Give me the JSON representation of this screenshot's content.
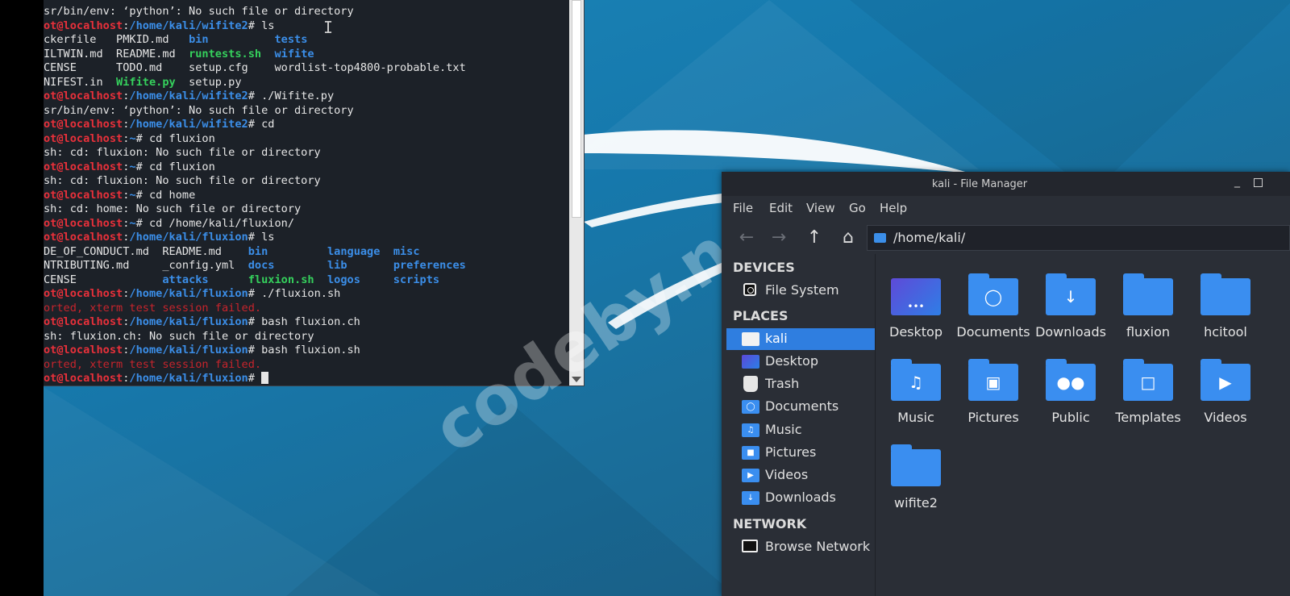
{
  "terminal": {
    "lines": [
      [
        {
          "t": "sr/bin/env: ‘python’: No such file or directory",
          "c": ""
        }
      ],
      [
        {
          "t": "ot@localhost",
          "c": "red"
        },
        {
          "t": ":",
          "c": ""
        },
        {
          "t": "/home/kali/wifite2",
          "c": "blue"
        },
        {
          "t": "# ls",
          "c": ""
        }
      ],
      [
        {
          "t": "ckerfile   PMKID.md   ",
          "c": ""
        },
        {
          "t": "bin",
          "c": "blue"
        },
        {
          "t": "          ",
          "c": ""
        },
        {
          "t": "tests",
          "c": "blue"
        }
      ],
      [
        {
          "t": "ILTWIN.md  README.md  ",
          "c": ""
        },
        {
          "t": "runtests.sh",
          "c": "green"
        },
        {
          "t": "  ",
          "c": ""
        },
        {
          "t": "wifite",
          "c": "blue"
        }
      ],
      [
        {
          "t": "CENSE      TODO.md    setup.cfg    wordlist-top4800-probable.txt",
          "c": ""
        }
      ],
      [
        {
          "t": "NIFEST.in  ",
          "c": ""
        },
        {
          "t": "Wifite.py",
          "c": "green"
        },
        {
          "t": "  setup.py",
          "c": ""
        }
      ],
      [
        {
          "t": "ot@localhost",
          "c": "red"
        },
        {
          "t": ":",
          "c": ""
        },
        {
          "t": "/home/kali/wifite2",
          "c": "blue"
        },
        {
          "t": "# ./Wifite.py",
          "c": ""
        }
      ],
      [
        {
          "t": "sr/bin/env: ‘python’: No such file or directory",
          "c": ""
        }
      ],
      [
        {
          "t": "ot@localhost",
          "c": "red"
        },
        {
          "t": ":",
          "c": ""
        },
        {
          "t": "/home/kali/wifite2",
          "c": "blue"
        },
        {
          "t": "# cd",
          "c": ""
        }
      ],
      [
        {
          "t": "ot@localhost",
          "c": "red"
        },
        {
          "t": ":",
          "c": ""
        },
        {
          "t": "~",
          "c": "blue"
        },
        {
          "t": "# cd fluxion",
          "c": ""
        }
      ],
      [
        {
          "t": "sh: cd: fluxion: No such file or directory",
          "c": ""
        }
      ],
      [
        {
          "t": "ot@localhost",
          "c": "red"
        },
        {
          "t": ":",
          "c": ""
        },
        {
          "t": "~",
          "c": "blue"
        },
        {
          "t": "# cd fluxion",
          "c": ""
        }
      ],
      [
        {
          "t": "sh: cd: fluxion: No such file or directory",
          "c": ""
        }
      ],
      [
        {
          "t": "ot@localhost",
          "c": "red"
        },
        {
          "t": ":",
          "c": ""
        },
        {
          "t": "~",
          "c": "blue"
        },
        {
          "t": "# cd home",
          "c": ""
        }
      ],
      [
        {
          "t": "sh: cd: home: No such file or directory",
          "c": ""
        }
      ],
      [
        {
          "t": "ot@localhost",
          "c": "red"
        },
        {
          "t": ":",
          "c": ""
        },
        {
          "t": "~",
          "c": "blue"
        },
        {
          "t": "# cd /home/kali/fluxion/",
          "c": ""
        }
      ],
      [
        {
          "t": "ot@localhost",
          "c": "red"
        },
        {
          "t": ":",
          "c": ""
        },
        {
          "t": "/home/kali/fluxion",
          "c": "blue"
        },
        {
          "t": "# ls",
          "c": ""
        }
      ],
      [
        {
          "t": "DE_OF_CONDUCT.md  README.md    ",
          "c": ""
        },
        {
          "t": "bin",
          "c": "blue"
        },
        {
          "t": "         ",
          "c": ""
        },
        {
          "t": "language",
          "c": "blue"
        },
        {
          "t": "  ",
          "c": ""
        },
        {
          "t": "misc",
          "c": "blue"
        }
      ],
      [
        {
          "t": "NTRIBUTING.md     _config.yml  ",
          "c": ""
        },
        {
          "t": "docs",
          "c": "blue"
        },
        {
          "t": "        ",
          "c": ""
        },
        {
          "t": "lib",
          "c": "blue"
        },
        {
          "t": "       ",
          "c": ""
        },
        {
          "t": "preferences",
          "c": "blue"
        }
      ],
      [
        {
          "t": "CENSE             ",
          "c": ""
        },
        {
          "t": "attacks",
          "c": "blue"
        },
        {
          "t": "      ",
          "c": ""
        },
        {
          "t": "fluxion.sh",
          "c": "green"
        },
        {
          "t": "  ",
          "c": ""
        },
        {
          "t": "logos",
          "c": "blue"
        },
        {
          "t": "     ",
          "c": ""
        },
        {
          "t": "scripts",
          "c": "blue"
        }
      ],
      [
        {
          "t": "ot@localhost",
          "c": "red"
        },
        {
          "t": ":",
          "c": ""
        },
        {
          "t": "/home/kali/fluxion",
          "c": "blue"
        },
        {
          "t": "# ./fluxion.sh",
          "c": ""
        }
      ],
      [
        {
          "t": "orted, xterm test session failed.",
          "c": "dred"
        }
      ],
      [
        {
          "t": "ot@localhost",
          "c": "red"
        },
        {
          "t": ":",
          "c": ""
        },
        {
          "t": "/home/kali/fluxion",
          "c": "blue"
        },
        {
          "t": "# bash fluxion.ch",
          "c": ""
        }
      ],
      [
        {
          "t": "sh: fluxion.ch: No such file or directory",
          "c": ""
        }
      ],
      [
        {
          "t": "ot@localhost",
          "c": "red"
        },
        {
          "t": ":",
          "c": ""
        },
        {
          "t": "/home/kali/fluxion",
          "c": "blue"
        },
        {
          "t": "# bash fluxion.sh",
          "c": ""
        }
      ],
      [
        {
          "t": "orted, xterm test session failed.",
          "c": "dred"
        }
      ],
      [
        {
          "t": "ot@localhost",
          "c": "red"
        },
        {
          "t": ":",
          "c": ""
        },
        {
          "t": "/home/kali/fluxion",
          "c": "blue"
        },
        {
          "t": "# ",
          "c": ""
        }
      ]
    ]
  },
  "file_manager": {
    "title": "kali - File Manager",
    "menu": [
      "File",
      "Edit",
      "View",
      "Go",
      "Help"
    ],
    "path": "/home/kali/",
    "sidebar": {
      "devices_header": "DEVICES",
      "devices": [
        {
          "label": "File System",
          "icon": "disk-icon"
        }
      ],
      "places_header": "PLACES",
      "places": [
        {
          "label": "kali",
          "icon": "home-folder-icon",
          "selected": true
        },
        {
          "label": "Desktop",
          "icon": "desktop-icon"
        },
        {
          "label": "Trash",
          "icon": "trash-icon"
        },
        {
          "label": "Documents",
          "icon": "documents-folder-icon"
        },
        {
          "label": "Music",
          "icon": "music-folder-icon"
        },
        {
          "label": "Pictures",
          "icon": "pictures-folder-icon"
        },
        {
          "label": "Videos",
          "icon": "videos-folder-icon"
        },
        {
          "label": "Downloads",
          "icon": "downloads-folder-icon"
        }
      ],
      "network_header": "NETWORK",
      "network": [
        {
          "label": "Browse Network",
          "icon": "network-icon"
        }
      ]
    },
    "items": [
      {
        "label": "Desktop",
        "icon": "desktop-icon"
      },
      {
        "label": "Documents",
        "icon": "documents-folder-icon"
      },
      {
        "label": "Downloads",
        "icon": "downloads-folder-icon"
      },
      {
        "label": "fluxion",
        "icon": "folder-icon"
      },
      {
        "label": "hcitool",
        "icon": "folder-icon"
      },
      {
        "label": "Music",
        "icon": "music-folder-icon"
      },
      {
        "label": "Pictures",
        "icon": "pictures-folder-icon"
      },
      {
        "label": "Public",
        "icon": "public-folder-icon"
      },
      {
        "label": "Templates",
        "icon": "templates-folder-icon"
      },
      {
        "label": "Videos",
        "icon": "videos-folder-icon"
      },
      {
        "label": "wifite2",
        "icon": "folder-icon"
      }
    ]
  },
  "watermark": "codeby.net",
  "colors": {
    "prompt_user": "#e8303a",
    "prompt_path": "#3b8ee8",
    "executable": "#35d05c",
    "selection": "#2f7ee0",
    "folder": "#3a8ef0"
  }
}
